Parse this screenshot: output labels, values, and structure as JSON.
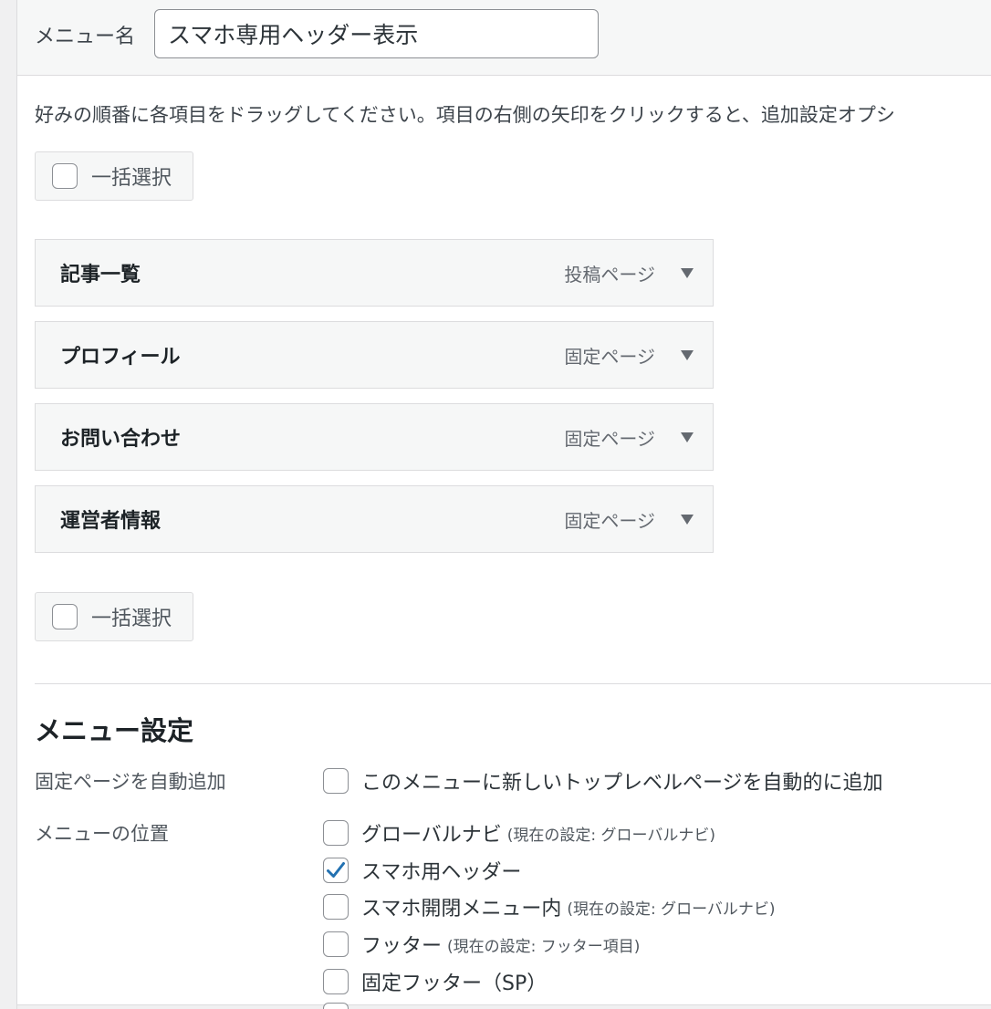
{
  "menu_name": {
    "label": "メニュー名",
    "value": "スマホ専用ヘッダー表示"
  },
  "instructions": "好みの順番に各項目をドラッグしてください。項目の右側の矢印をクリックすると、追加設定オプシ",
  "bulk_select": {
    "label": "一括選択",
    "checked": false
  },
  "menu_items": [
    {
      "title": "記事一覧",
      "type": "投稿ページ"
    },
    {
      "title": "プロフィール",
      "type": "固定ページ"
    },
    {
      "title": "お問い合わせ",
      "type": "固定ページ"
    },
    {
      "title": "運営者情報",
      "type": "固定ページ"
    }
  ],
  "settings": {
    "title": "メニュー設定",
    "auto_add": {
      "label": "固定ページを自動追加",
      "option": "このメニューに新しいトップレベルページを自動的に追加",
      "checked": false
    },
    "locations": {
      "label": "メニューの位置",
      "options": [
        {
          "label": "グローバルナビ",
          "note": "(現在の設定: グローバルナビ)",
          "checked": false
        },
        {
          "label": "スマホ用ヘッダー",
          "note": "",
          "checked": true
        },
        {
          "label": "スマホ開閉メニュー内",
          "note": "(現在の設定: グローバルナビ)",
          "checked": false
        },
        {
          "label": "フッター",
          "note": "(現在の設定: フッター項目)",
          "checked": false
        },
        {
          "label": "固定フッター（SP）",
          "note": "",
          "checked": false
        }
      ]
    }
  },
  "colors": {
    "checkmark": "#2271b1",
    "panel_bg": "#f6f7f7",
    "border": "#dcdcde"
  },
  "icons": {
    "item_toggle": "triangle-down-icon",
    "checkbox_checked": "checkmark-icon"
  }
}
